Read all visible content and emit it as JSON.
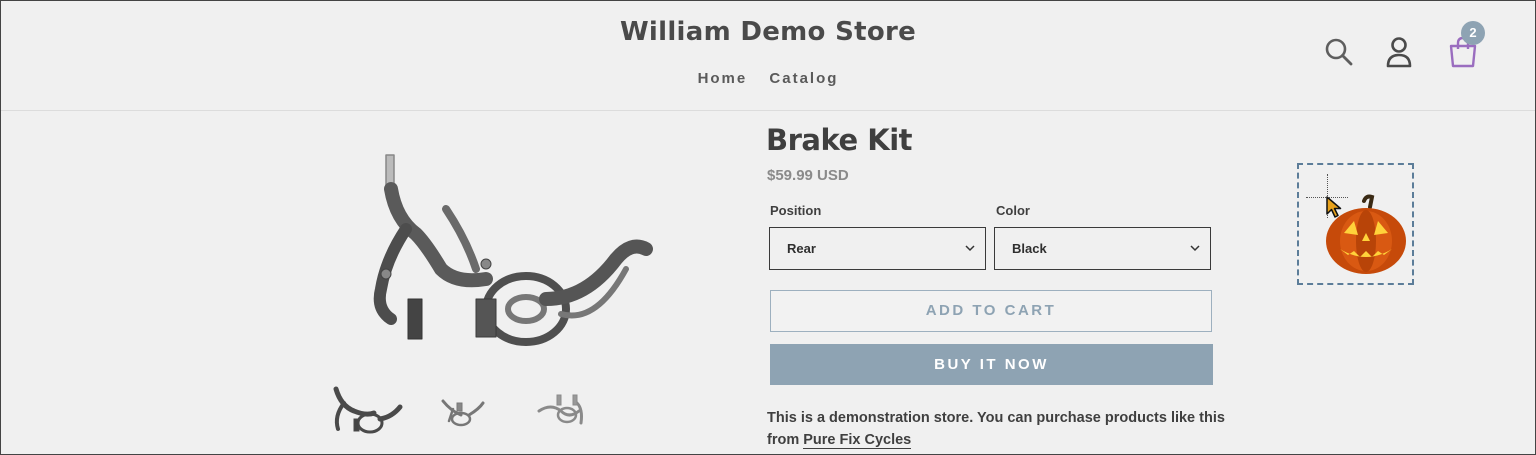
{
  "header": {
    "store_name": "William Demo Store",
    "nav": [
      {
        "label": "Home"
      },
      {
        "label": "Catalog"
      }
    ],
    "icons": {
      "search": "search-icon",
      "account": "user-icon",
      "cart": "shopping-bag-icon"
    },
    "cart_count": "2"
  },
  "product": {
    "title": "Brake Kit",
    "price": "$59.99 USD",
    "options": [
      {
        "label": "Position",
        "value": "Rear"
      },
      {
        "label": "Color",
        "value": "Black"
      }
    ],
    "add_to_cart": "ADD TO CART",
    "buy_now": "BUY IT NOW",
    "description_text": "This is a demonstration store. You can purchase products like this from ",
    "description_link": "Pure Fix Cycles"
  },
  "colors": {
    "accent": "#8ea3b3",
    "cart_icon": "#9a6dbf",
    "background": "#f0f0f0"
  },
  "decoration": {
    "icon": "jack-o-lantern-icon",
    "cursor": "cursor-arrow-icon"
  }
}
